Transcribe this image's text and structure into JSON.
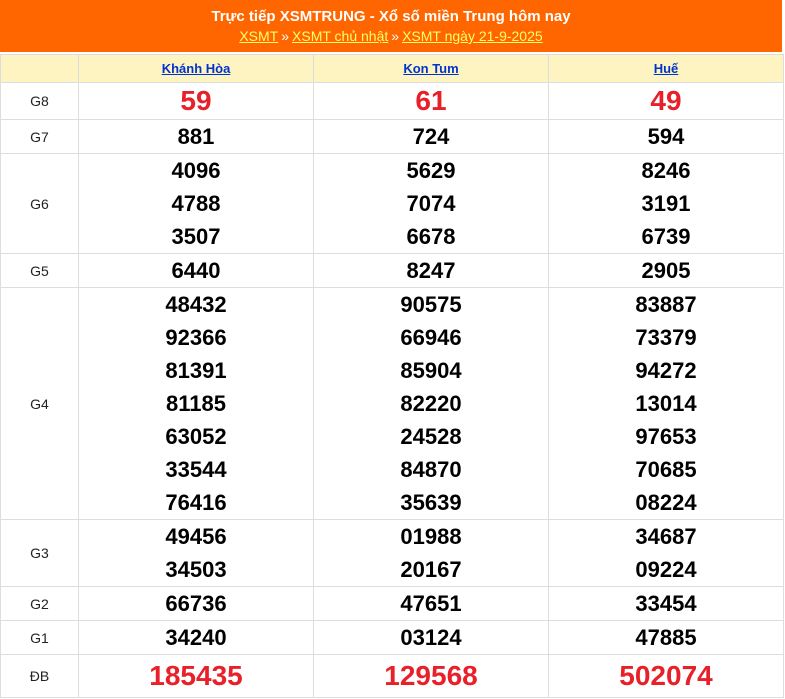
{
  "header": {
    "title": "Trực tiếp XSMTRUNG - Xổ số miền Trung hôm nay",
    "breadcrumbs": [
      "XSMT",
      "XSMT chủ nhật",
      "XSMT ngày 21-9-2025"
    ],
    "separator": "»"
  },
  "provinces": [
    "Khánh Hòa",
    "Kon Tum",
    "Huế"
  ],
  "prizes": [
    {
      "label": "G8",
      "style": "big",
      "results": [
        [
          "59"
        ],
        [
          "61"
        ],
        [
          "49"
        ]
      ]
    },
    {
      "label": "G7",
      "style": "normal",
      "results": [
        [
          "881"
        ],
        [
          "724"
        ],
        [
          "594"
        ]
      ]
    },
    {
      "label": "G6",
      "style": "normal",
      "results": [
        [
          "4096",
          "4788",
          "3507"
        ],
        [
          "5629",
          "7074",
          "6678"
        ],
        [
          "8246",
          "3191",
          "6739"
        ]
      ]
    },
    {
      "label": "G5",
      "style": "normal",
      "results": [
        [
          "6440"
        ],
        [
          "8247"
        ],
        [
          "2905"
        ]
      ]
    },
    {
      "label": "G4",
      "style": "normal",
      "results": [
        [
          "48432",
          "92366",
          "81391",
          "81185",
          "63052",
          "33544",
          "76416"
        ],
        [
          "90575",
          "66946",
          "85904",
          "82220",
          "24528",
          "84870",
          "35639"
        ],
        [
          "83887",
          "73379",
          "94272",
          "13014",
          "97653",
          "70685",
          "08224"
        ]
      ]
    },
    {
      "label": "G3",
      "style": "normal",
      "results": [
        [
          "49456",
          "34503"
        ],
        [
          "01988",
          "20167"
        ],
        [
          "34687",
          "09224"
        ]
      ]
    },
    {
      "label": "G2",
      "style": "normal",
      "results": [
        [
          "66736"
        ],
        [
          "47651"
        ],
        [
          "33454"
        ]
      ]
    },
    {
      "label": "G1",
      "style": "normal",
      "results": [
        [
          "34240"
        ],
        [
          "03124"
        ],
        [
          "47885"
        ]
      ]
    },
    {
      "label": "ĐB",
      "style": "db",
      "results": [
        [
          "185435"
        ],
        [
          "129568"
        ],
        [
          "502074"
        ]
      ]
    }
  ],
  "colors": {
    "header_bg": "#ff6600",
    "link_yellow": "#ffff66",
    "province_header_bg": "#fef4c2",
    "province_link": "#0033cc",
    "highlight_red": "#e8202a"
  }
}
